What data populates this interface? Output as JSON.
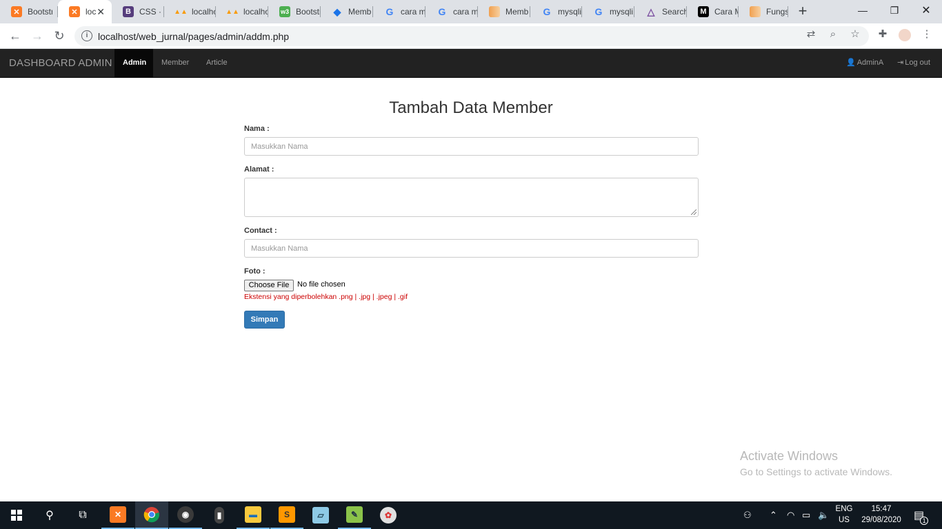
{
  "browser": {
    "tabs": [
      {
        "title": "Bootstr",
        "icon": "xampp-icon",
        "color": "#fb7a24"
      },
      {
        "title": "loc",
        "icon": "xampp-icon",
        "color": "#fb7a24",
        "active": true
      },
      {
        "title": "CSS · B",
        "icon": "bootstrap-icon",
        "color": "#563d7c"
      },
      {
        "title": "localho",
        "icon": "phpmyadmin-icon",
        "color": "#f89c0e"
      },
      {
        "title": "localho",
        "icon": "phpmyadmin-icon",
        "color": "#f89c0e"
      },
      {
        "title": "Bootstr",
        "icon": "w3schools-icon",
        "color": "#4caf50"
      },
      {
        "title": "Memb",
        "icon": "diamond-icon",
        "color": "#1a73e8"
      },
      {
        "title": "cara m",
        "icon": "google-icon",
        "color": "#4285f4"
      },
      {
        "title": "cara m",
        "icon": "google-icon",
        "color": "#4285f4"
      },
      {
        "title": "Memb",
        "icon": "bookmark-icon",
        "color": "#f0a050"
      },
      {
        "title": "mysqli",
        "icon": "google-icon",
        "color": "#4285f4"
      },
      {
        "title": "mysqli",
        "icon": "google-icon",
        "color": "#4285f4"
      },
      {
        "title": "Search",
        "icon": "triangle-icon",
        "color": "#7b4fa0"
      },
      {
        "title": "Cara M",
        "icon": "medium-icon",
        "color": "#000000"
      },
      {
        "title": "Fungsi",
        "icon": "bookmark-icon",
        "color": "#f0a050"
      }
    ],
    "url": "localhost/web_jurnal/pages/admin/addm.php"
  },
  "navbar": {
    "brand": "DASHBOARD ADMIN",
    "links": [
      "Admin",
      "Member",
      "Article"
    ],
    "active": "Admin",
    "user": "AdminA",
    "logout": "Log out"
  },
  "form": {
    "title": "Tambah Data Member",
    "nama_label": "Nama :",
    "nama_placeholder": "Masukkan Nama",
    "alamat_label": "Alamat :",
    "contact_label": "Contact :",
    "contact_placeholder": "Masukkan Nama",
    "foto_label": "Foto :",
    "choose_file": "Choose File",
    "no_file": "No file chosen",
    "hint": "Ekstensi yang diperbolehkan .png | .jpg | .jpeg | .gif",
    "submit": "Simpan"
  },
  "watermark": {
    "line1": "Activate Windows",
    "line2": "Go to Settings to activate Windows."
  },
  "taskbar": {
    "lang_top": "ENG",
    "lang_bottom": "US",
    "time": "15:47",
    "date": "29/08/2020",
    "notifications": "1"
  },
  "colors": {
    "navbar_bg": "#222222",
    "primary": "#337ab7",
    "hint": "#cc0000"
  }
}
